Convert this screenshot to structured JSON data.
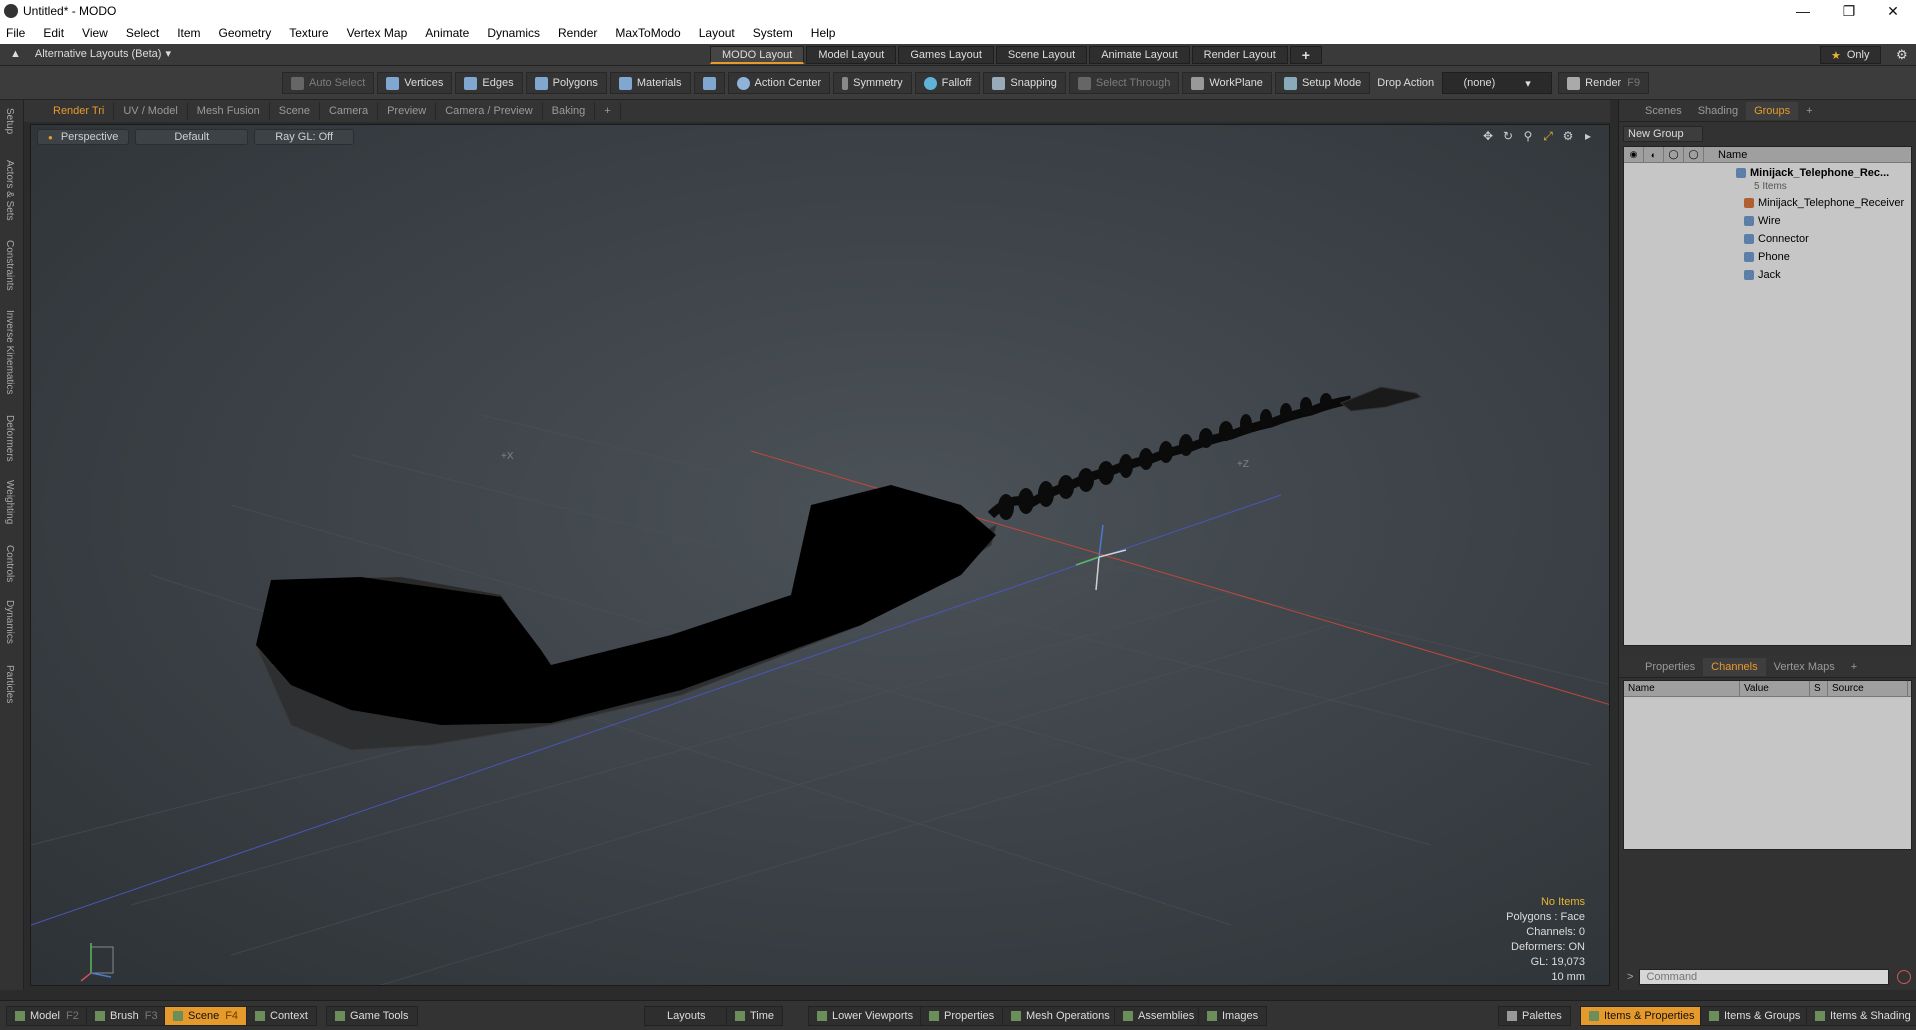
{
  "window": {
    "title": "Untitled* - MODO"
  },
  "menu": [
    "File",
    "Edit",
    "View",
    "Select",
    "Item",
    "Geometry",
    "Texture",
    "Vertex Map",
    "Animate",
    "Dynamics",
    "Render",
    "MaxToModo",
    "Layout",
    "System",
    "Help"
  ],
  "layouts": {
    "alt_label": "Alternative Layouts (Beta)",
    "tabs": [
      "MODO Layout",
      "Model Layout",
      "Games Layout",
      "Scene Layout",
      "Animate Layout",
      "Render Layout"
    ],
    "active": "MODO Layout",
    "add": "+",
    "only": "Only"
  },
  "toolbar": {
    "auto_select": "Auto Select",
    "vertices": "Vertices",
    "edges": "Edges",
    "polygons": "Polygons",
    "materials": "Materials",
    "action_center": "Action Center",
    "symmetry": "Symmetry",
    "falloff": "Falloff",
    "snapping": "Snapping",
    "select_through": "Select Through",
    "workplane": "WorkPlane",
    "setup_mode": "Setup Mode",
    "drop_action": "Drop Action",
    "drop_value": "(none)",
    "render": "Render",
    "render_key": "F9"
  },
  "left_tabs": [
    "Setup",
    "Actors & Sets",
    "Constraints",
    "Inverse Kinematics",
    "Deformers",
    "Weighting",
    "Controls",
    "Dynamics",
    "Particles"
  ],
  "viewport_tabs": [
    "Render Tri",
    "UV / Model",
    "Mesh Fusion",
    "Scene",
    "Camera",
    "Preview",
    "Camera / Preview",
    "Baking",
    "+"
  ],
  "viewport": {
    "view": "Perspective",
    "style": "Default",
    "raygl": "Ray GL: Off",
    "axis_x_label": "+X",
    "axis_z_label": "+Z",
    "info": {
      "items": "No Items",
      "polygons": "Polygons : Face",
      "channels": "Channels: 0",
      "deformers": "Deformers: ON",
      "gl": "GL: 19,073",
      "unit": "10 mm"
    }
  },
  "right_panel": {
    "top_tabs": [
      "Scenes",
      "Shading",
      "Groups",
      "+"
    ],
    "active_top": "Groups",
    "new_group": "New Group",
    "name_header": "Name",
    "group_name": "Minijack_Telephone_Rec...",
    "group_count": "5 Items",
    "items": [
      "Minijack_Telephone_Receiver",
      "Wire",
      "Connector",
      "Phone",
      "Jack"
    ],
    "bottom_tabs": [
      "Properties",
      "Channels",
      "Vertex Maps",
      "+"
    ],
    "active_bottom": "Channels",
    "channel_cols": [
      "Name",
      "Value",
      "S",
      "Source"
    ],
    "command_placeholder": "Command"
  },
  "statusbar": {
    "model": "Model",
    "model_key": "F2",
    "brush": "Brush",
    "brush_key": "F3",
    "scene": "Scene",
    "scene_key": "F4",
    "context": "Context",
    "game_tools": "Game Tools",
    "layouts": "Layouts",
    "time": "Time",
    "lower_viewports": "Lower Viewports",
    "properties": "Properties",
    "mesh_operations": "Mesh Operations",
    "assemblies": "Assemblies",
    "images": "Images",
    "palettes": "Palettes",
    "items_properties": "Items & Properties",
    "items_groups": "Items & Groups",
    "items_shading": "Items & Shading"
  },
  "colors": {
    "accent": "#e79a2c",
    "panel": "#323232",
    "list_bg": "#c6c6c6"
  }
}
